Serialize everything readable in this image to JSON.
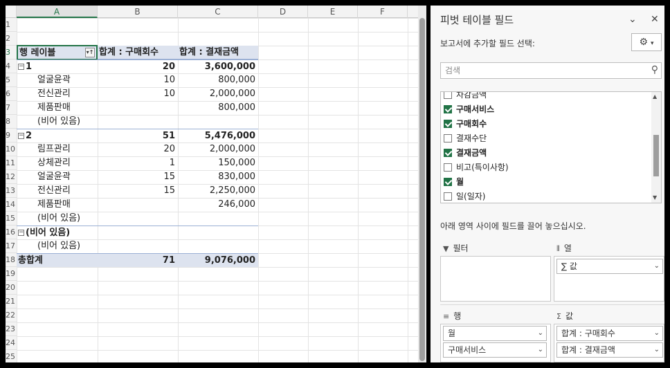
{
  "sheet": {
    "columns": [
      "A",
      "B",
      "C",
      "D",
      "E",
      "F"
    ],
    "selected_column": "A",
    "rows": [
      "1",
      "2",
      "3",
      "4",
      "5",
      "6",
      "7",
      "8",
      "9",
      "10",
      "11",
      "12",
      "13",
      "14",
      "15",
      "16",
      "17",
      "18",
      "19",
      "20",
      "21",
      "22",
      "23",
      "24",
      "25"
    ],
    "selected_row": "3"
  },
  "pivot": {
    "header": {
      "row_labels": "행 레이블",
      "col_b": "합계 : 구매회수",
      "col_c": "합계 : 결재금액"
    },
    "rows": [
      {
        "type": "group",
        "expander": "−",
        "label": "1",
        "b": "20",
        "c": "3,600,000"
      },
      {
        "type": "item",
        "label": "얼굴윤곽",
        "b": "10",
        "c": "800,000"
      },
      {
        "type": "item",
        "label": "전신관리",
        "b": "10",
        "c": "2,000,000"
      },
      {
        "type": "item",
        "label": "제품판매",
        "b": "",
        "c": "800,000"
      },
      {
        "type": "item",
        "label": "(비어 있음)",
        "b": "",
        "c": ""
      },
      {
        "type": "group",
        "expander": "−",
        "label": "2",
        "b": "51",
        "c": "5,476,000"
      },
      {
        "type": "item",
        "label": "림프관리",
        "b": "20",
        "c": "2,000,000"
      },
      {
        "type": "item",
        "label": "상체관리",
        "b": "1",
        "c": "150,000"
      },
      {
        "type": "item",
        "label": "얼굴윤곽",
        "b": "15",
        "c": "830,000"
      },
      {
        "type": "item",
        "label": "전신관리",
        "b": "15",
        "c": "2,250,000"
      },
      {
        "type": "item",
        "label": "제품판매",
        "b": "",
        "c": "246,000"
      },
      {
        "type": "item",
        "label": "(비어 있음)",
        "b": "",
        "c": ""
      },
      {
        "type": "group",
        "expander": "−",
        "label": "(비어 있음)",
        "b": "",
        "c": ""
      },
      {
        "type": "item",
        "label": "(비어 있음)",
        "b": "",
        "c": ""
      }
    ],
    "total": {
      "label": "총합계",
      "b": "71",
      "c": "9,076,000"
    }
  },
  "panel": {
    "title": "피벗 테이블 필드",
    "choose_label": "보고서에 추가할 필드 선택:",
    "search_placeholder": "검색",
    "fields": [
      {
        "label": "차감금액",
        "checked": false
      },
      {
        "label": "구매서비스",
        "checked": true
      },
      {
        "label": "구매회수",
        "checked": true
      },
      {
        "label": "결재수단",
        "checked": false
      },
      {
        "label": "결재금액",
        "checked": true
      },
      {
        "label": "비고(특이사항)",
        "checked": false
      },
      {
        "label": "월",
        "checked": true
      },
      {
        "label": "일(일자)",
        "checked": false
      }
    ],
    "drag_label": "아래 영역 사이에 필드를 끌어 놓으십시오.",
    "areas": {
      "filters": {
        "title": "필터",
        "items": []
      },
      "columns": {
        "title": "열",
        "items": [
          "∑ 값"
        ]
      },
      "rows": {
        "title": "행",
        "items": [
          "월",
          "구매서비스"
        ]
      },
      "values": {
        "title": "값",
        "items": [
          "합계 : 구매회수",
          "합계 : 결재금액"
        ]
      }
    }
  }
}
